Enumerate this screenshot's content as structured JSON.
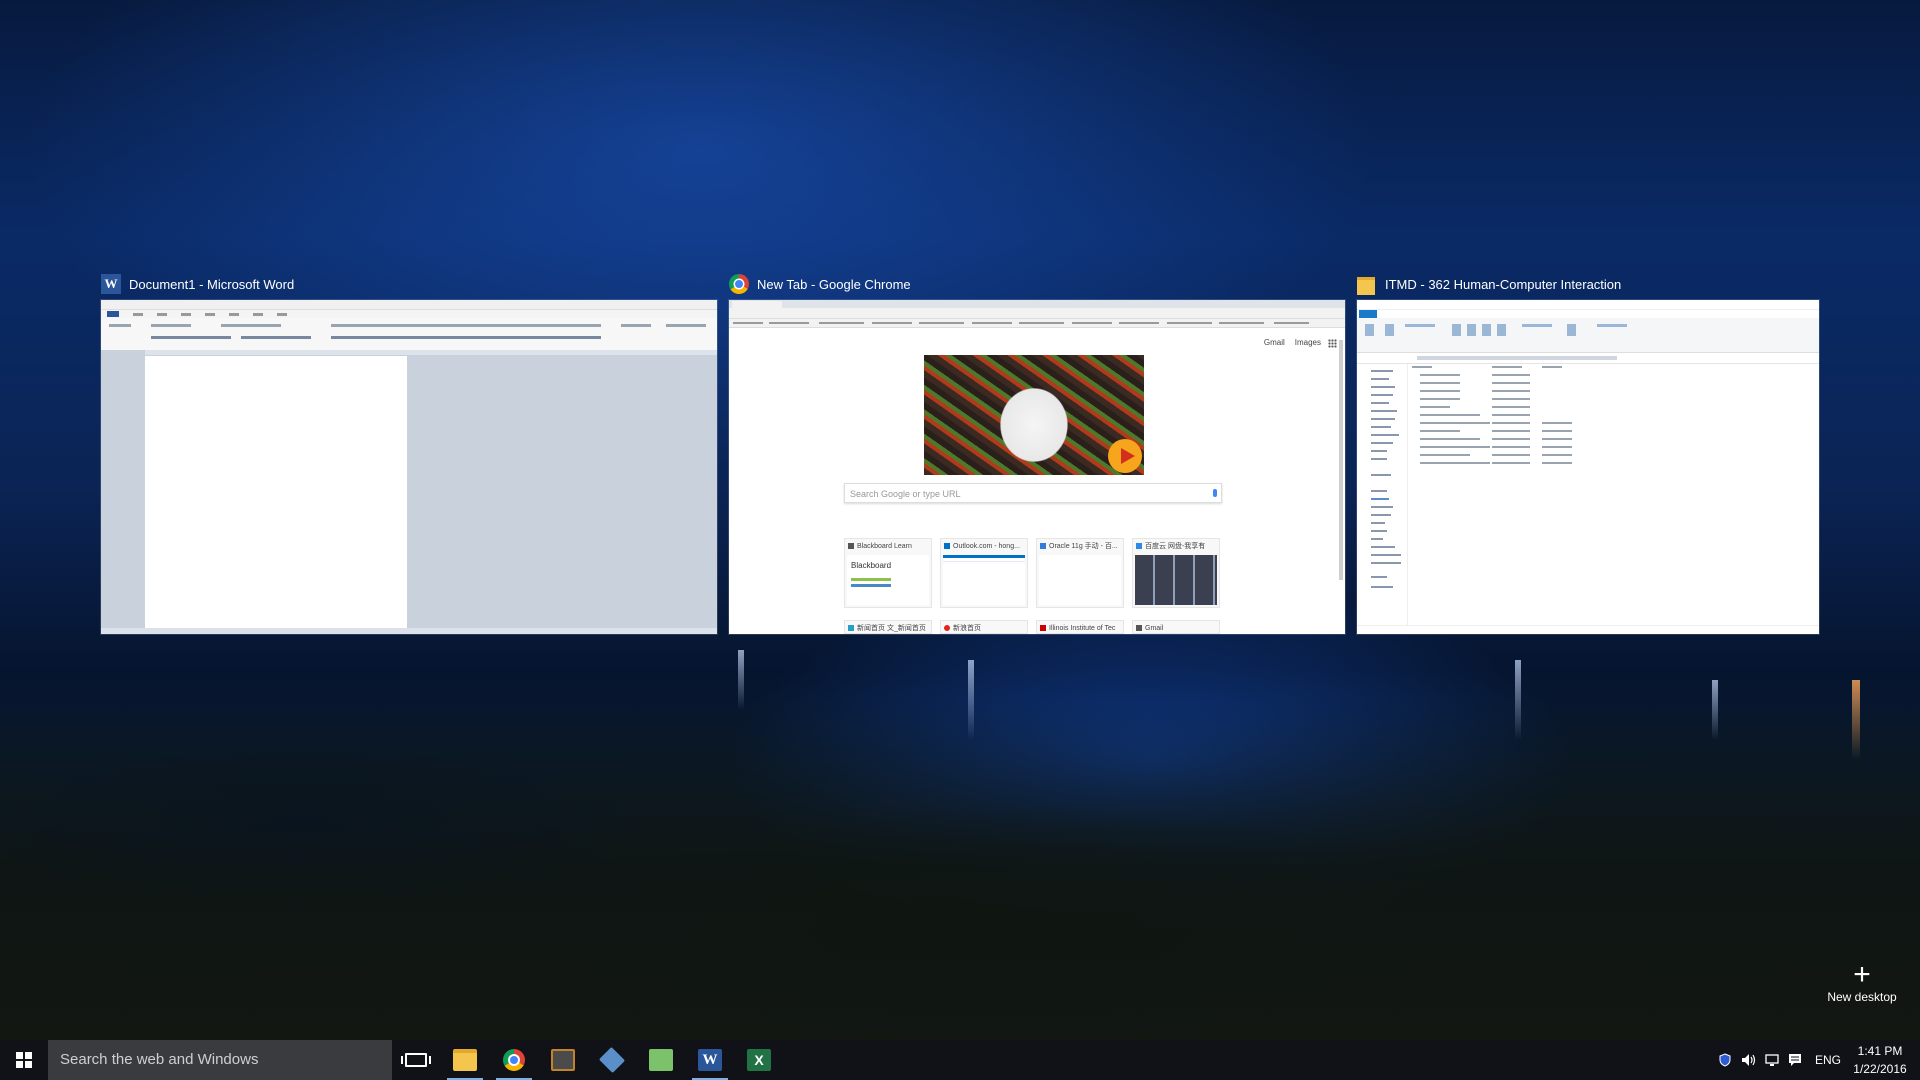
{
  "windows": [
    {
      "title": "Document1 - Microsoft Word",
      "icon": "word-icon"
    },
    {
      "title": "New Tab - Google Chrome",
      "icon": "chrome-icon"
    },
    {
      "title": "ITMD - 362 Human-Computer Interaction",
      "icon": "folder-icon"
    }
  ],
  "chrome_page": {
    "top_links": [
      "Gmail",
      "Images"
    ],
    "search_placeholder": "Search Google or type URL",
    "tiles": [
      {
        "label": "Blackboard Learn",
        "preview_text": "Blackboard",
        "color": "#555555"
      },
      {
        "label": "Outlook.com - hong...",
        "preview_text": "",
        "color": "#0072c6"
      },
      {
        "label": "Oracle 11g 手动 - 百...",
        "preview_text": "",
        "color": "#2e7fd5"
      },
      {
        "label": "百度云 网盘-我享有",
        "preview_text": "",
        "color": "#2c8ae6"
      },
      {
        "label": "新闻首页 文_新闻首页",
        "preview_text": "",
        "color": "#27a0c8"
      },
      {
        "label": "新浪首页",
        "preview_text": "",
        "color": "#e2231a"
      },
      {
        "label": "Illinois Institute of Tec",
        "preview_text": "",
        "color": "#cc0000"
      },
      {
        "label": "Gmail",
        "preview_text": "",
        "color": "#555555"
      }
    ]
  },
  "new_desktop": {
    "label": "New desktop"
  },
  "taskbar": {
    "search_placeholder": "Search the web and Windows",
    "apps": [
      {
        "name": "file-explorer",
        "active": true
      },
      {
        "name": "google-chrome",
        "active": true
      },
      {
        "name": "sublime-text",
        "active": false
      },
      {
        "name": "virtualbox",
        "active": false
      },
      {
        "name": "calculator",
        "active": false
      },
      {
        "name": "microsoft-word",
        "active": true
      },
      {
        "name": "microsoft-excel",
        "active": false
      }
    ],
    "language": "ENG",
    "time": "1:41 PM",
    "date": "1/22/2016"
  },
  "colors": {
    "taskbar_bg": "#101218",
    "search_bg": "#3a3b3f",
    "word_blue": "#2b579a",
    "explorer_blue": "#1979ca",
    "folder_yellow": "#f4c64e"
  }
}
